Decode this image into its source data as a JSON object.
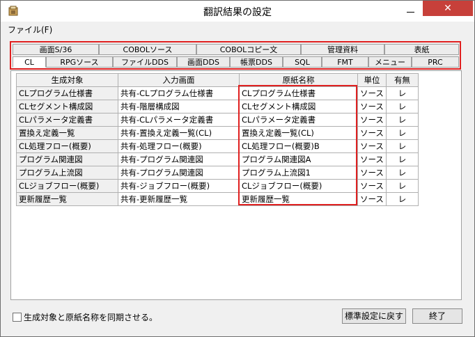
{
  "window": {
    "title": "翻訳結果の設定",
    "close_glyph": "✕"
  },
  "menu": {
    "file": "ファイル(F)"
  },
  "tabs": {
    "row1": [
      "画面S/36",
      "COBOLソース",
      "COBOLコピー文",
      "管理資料",
      "表紙"
    ],
    "row2": [
      "CL",
      "RPGソース",
      "ファイルDDS",
      "画面DDS",
      "帳票DDS",
      "SQL",
      "FMT",
      "メニュー",
      "PRC"
    ],
    "active": "CL"
  },
  "table": {
    "headers": [
      "生成対象",
      "入力画面",
      "原紙名称",
      "単位",
      "有無"
    ],
    "rows": [
      [
        "CLプログラム仕様書",
        "共有-CLプログラム仕様書",
        "CLプログラム仕様書",
        "ソース",
        "レ"
      ],
      [
        "CLセグメント構成図",
        "共有-階層構成図",
        "CLセグメント構成図",
        "ソース",
        "レ"
      ],
      [
        "CLパラメータ定義書",
        "共有-CLパラメータ定義書",
        "CLパラメータ定義書",
        "ソース",
        "レ"
      ],
      [
        "置換え定義一覧",
        "共有-置換え定義一覧(CL)",
        "置換え定義一覧(CL)",
        "ソース",
        "レ"
      ],
      [
        "CL処理フロー(概要)",
        "共有-処理フロー(概要)",
        "CL処理フロー(概要)B",
        "ソース",
        "レ"
      ],
      [
        "プログラム関連図",
        "共有-プログラム関連図",
        "プログラム関連図A",
        "ソース",
        "レ"
      ],
      [
        "プログラム上流図",
        "共有-プログラム関連図",
        "プログラム上流図1",
        "ソース",
        "レ"
      ],
      [
        "CLジョブフロー(概要)",
        "共有-ジョブフロー(概要)",
        "CLジョブフロー(概要)",
        "ソース",
        "レ"
      ],
      [
        "更新履歴一覧",
        "共有-更新履歴一覧",
        "更新履歴一覧",
        "ソース",
        "レ"
      ]
    ]
  },
  "sync_checkbox": {
    "label": "生成対象と原紙名称を同期させる。",
    "checked": false
  },
  "buttons": {
    "reset": "標準設定に戻す",
    "close": "終了"
  },
  "colors": {
    "highlight": "#e02020",
    "close_button": "#c7403a"
  }
}
